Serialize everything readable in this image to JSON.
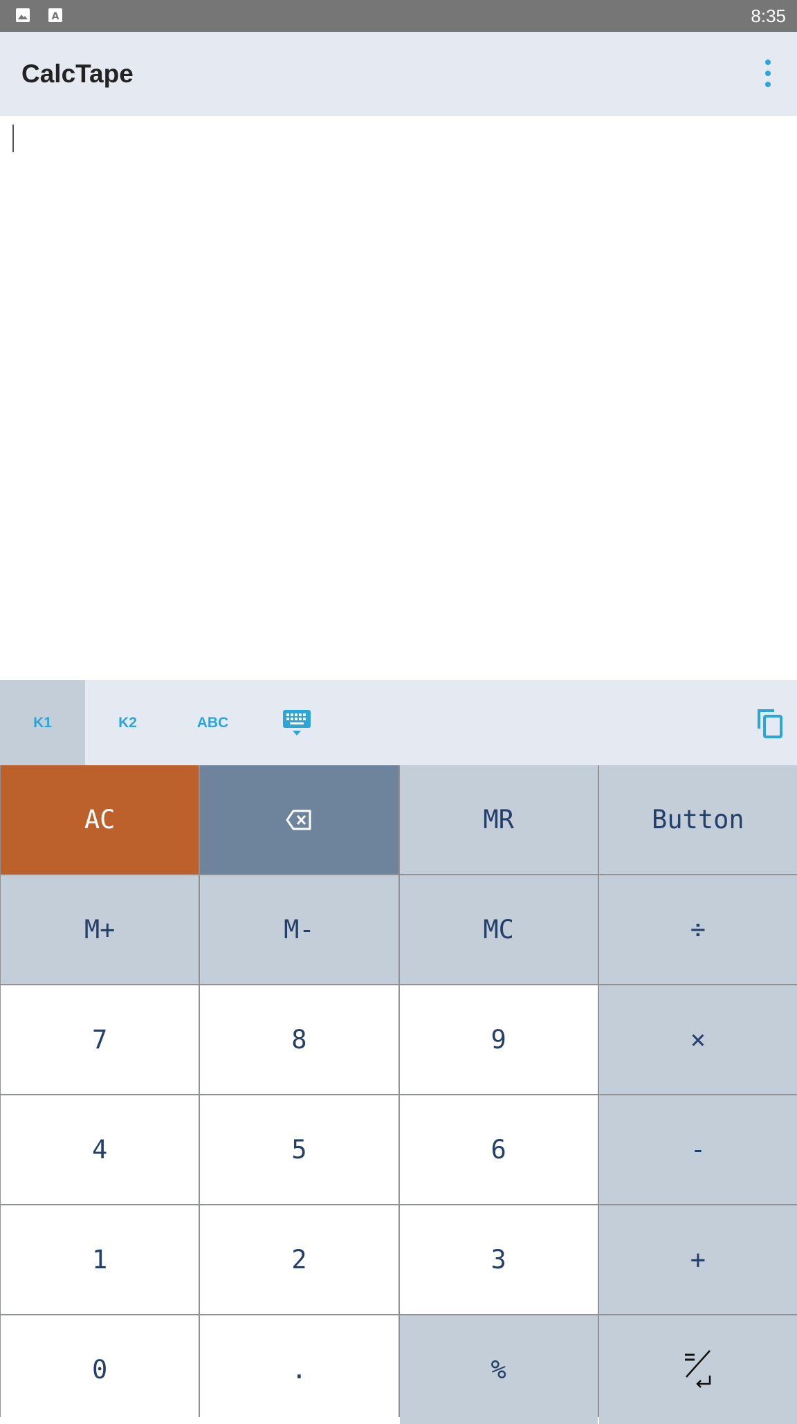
{
  "status_bar": {
    "time": "8:35",
    "icons": [
      "image-icon",
      "text-a-icon"
    ]
  },
  "app_bar": {
    "title": "CalcTape",
    "menu_icon": "more-vert-icon"
  },
  "keyboard_tabs": [
    {
      "label": "K1",
      "active": true
    },
    {
      "label": "K2",
      "active": false
    },
    {
      "label": "ABC",
      "active": false
    }
  ],
  "toolbar_icons": {
    "keyboard": "keyboard-hide-icon",
    "copy": "copy-icon"
  },
  "keys": {
    "ac": "AC",
    "backspace_icon": "backspace-icon",
    "mr": "MR",
    "button": "Button",
    "m_plus": "M+",
    "m_minus": "M-",
    "mc": "MC",
    "divide": "÷",
    "seven": "7",
    "eight": "8",
    "nine": "9",
    "multiply": "×",
    "four": "4",
    "five": "5",
    "six": "6",
    "minus": "-",
    "one": "1",
    "two": "2",
    "three": "3",
    "plus": "+",
    "zero": "0",
    "dot": ".",
    "percent": "%",
    "equals_enter_icon": "equals-enter-icon"
  },
  "colors": {
    "accent": "#2ba6d9",
    "ac_key": "#bd612c",
    "backspace_key": "#6d849c",
    "function_key": "#c4ced8",
    "key_text": "#24406a",
    "app_bar": "#e5eaf2",
    "status_bar": "#767676"
  }
}
